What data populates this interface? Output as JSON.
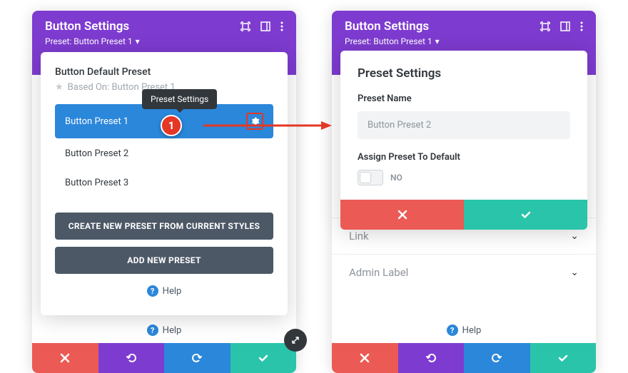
{
  "left": {
    "title": "Button Settings",
    "preset_label": "Preset: Button Preset 1",
    "dropdown": {
      "default_title": "Button Default Preset",
      "based_on": "Based On: Button Preset 1",
      "items": [
        "Button Preset 1",
        "Button Preset 2",
        "Button Preset 3"
      ],
      "btn_create": "CREATE NEW PRESET FROM CURRENT STYLES",
      "btn_add": "ADD NEW PRESET",
      "help": "Help"
    },
    "help": "Help"
  },
  "right": {
    "title": "Button Settings",
    "preset_label": "Preset: Button Preset 1",
    "popup": {
      "title": "Preset Settings",
      "name_label": "Preset Name",
      "name_value": "Button Preset 2",
      "assign_label": "Assign Preset To Default",
      "toggle_state": "NO"
    },
    "sections": [
      "Link",
      "Admin Label"
    ],
    "help": "Help"
  },
  "tooltip": "Preset Settings",
  "callout": "1"
}
